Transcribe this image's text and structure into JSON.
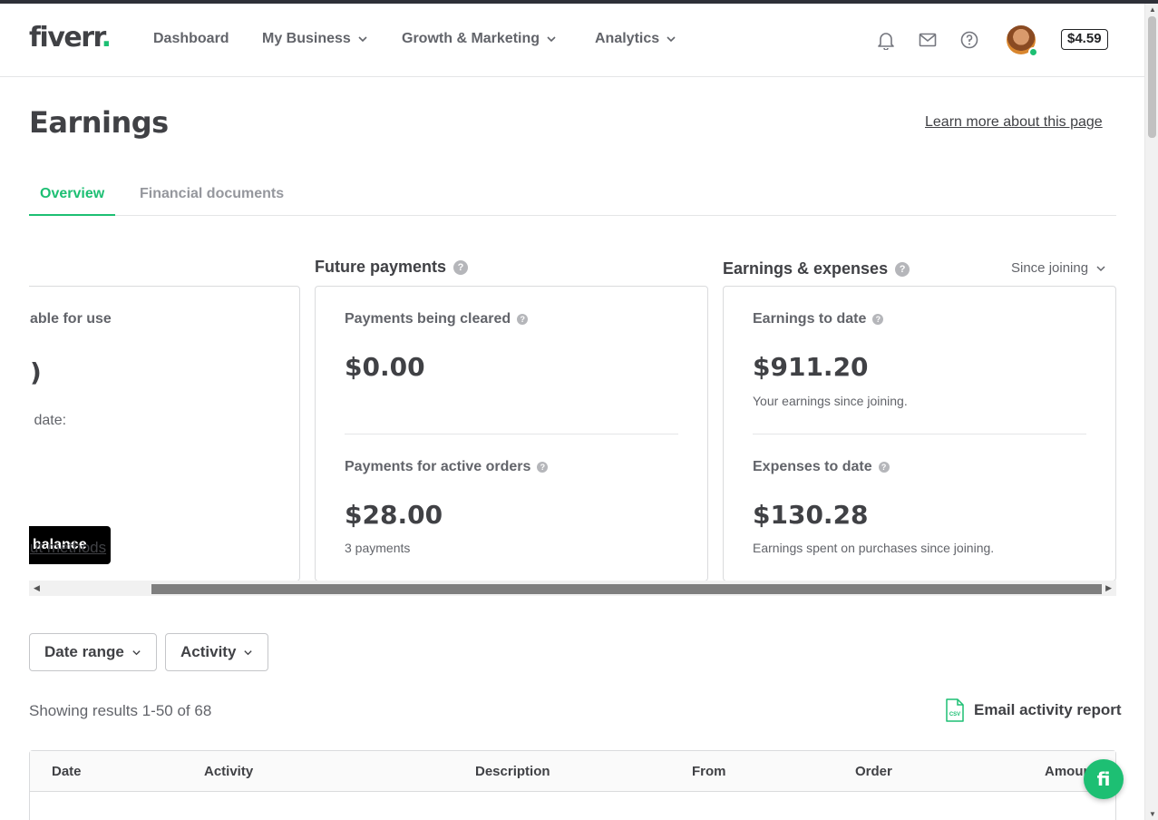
{
  "header": {
    "logo_text": "fiverr",
    "logo_dot": ".",
    "nav": [
      {
        "label": "Dashboard"
      },
      {
        "label": "My Business"
      },
      {
        "label": "Growth & Marketing"
      },
      {
        "label": "Analytics"
      }
    ],
    "icons": [
      "bell-icon",
      "mail-icon",
      "help-icon"
    ],
    "balance": "$4.59"
  },
  "page": {
    "title": "Earnings",
    "learn_more": "Learn more about this page"
  },
  "tabs": [
    {
      "label": "Overview",
      "active": true
    },
    {
      "label": "Financial documents",
      "active": false
    }
  ],
  "available": {
    "label_partial": "able for use",
    "amount_partial": ")",
    "sub_partial": "​ date:",
    "button_partial": "balance",
    "link_partial": "ut methods"
  },
  "future_payments": {
    "title": "Future payments",
    "cleared_label": "Payments being cleared",
    "cleared_amount": "$0.00",
    "active_label": "Payments for active orders",
    "active_amount": "$28.00",
    "active_sub": "3 payments"
  },
  "earnings_expenses": {
    "title": "Earnings & expenses",
    "period": "Since joining",
    "earnings_label": "Earnings to date",
    "earnings_amount": "$911.20",
    "earnings_sub": "Your earnings since joining.",
    "expenses_label": "Expenses to date",
    "expenses_amount": "$130.28",
    "expenses_sub": "Earnings spent on purchases since joining."
  },
  "filters": {
    "date_range": "Date range",
    "activity": "Activity"
  },
  "results": {
    "text": "Showing results 1-50 of 68",
    "email_report": "Email activity report",
    "csv_label": "CSV"
  },
  "table": {
    "columns": [
      "Date",
      "Activity",
      "Description",
      "From",
      "Order",
      "Amount"
    ]
  },
  "chat": {
    "glyph": "fi"
  },
  "colors": {
    "brand_green": "#1dbf73",
    "text_dark": "#404145"
  }
}
